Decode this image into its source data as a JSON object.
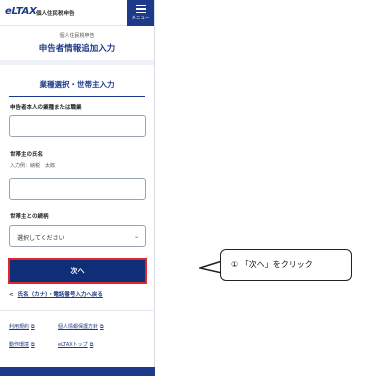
{
  "app": {
    "logo": "eLTAX",
    "title": "個人住民税申告",
    "menu_label": "メニュー"
  },
  "header": {
    "subtitle": "個人住民税申告",
    "title": "申告者情報追加入力"
  },
  "section": {
    "title": "業種選択・世帯主入力"
  },
  "fields": {
    "occupation_label": "申告者本人の業種または職業",
    "occupation_value": "",
    "householder_label": "世帯主の氏名",
    "householder_hint": "入力例：納税　太郎",
    "householder_value": "",
    "relation_label": "世帯主との続柄",
    "relation_value": "選択してください"
  },
  "buttons": {
    "next": "次へ"
  },
  "back_link": {
    "arrow": "<",
    "label": "氏名（カナ）・電話番号入力へ戻る"
  },
  "footer": {
    "terms": "利用規約",
    "privacy": "個人情報保護方針",
    "env": "動作環境",
    "top": "eLTAXトップ"
  },
  "callout": {
    "text": "① 「次へ」をクリック"
  },
  "colors": {
    "brand": "#1d3a8a",
    "button": "#0f2e78",
    "highlight": "#e3242b"
  }
}
